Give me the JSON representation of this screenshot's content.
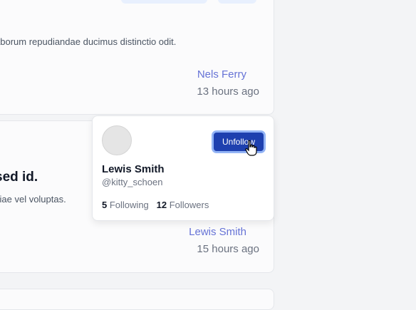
{
  "post1": {
    "excerpt": "aborum repudiandae ducimus distinctio odit.",
    "author": "Nels Ferry",
    "time": "13 hours ago"
  },
  "post2": {
    "title": "sed id.",
    "excerpt": "ciae vel voluptas.",
    "author": "Lewis Smith",
    "time": "15 hours ago"
  },
  "hovercard": {
    "name": "Lewis Smith",
    "handle": "@kitty_schoen",
    "following_count": "5",
    "following_label": "Following",
    "followers_count": "12",
    "followers_label": "Followers",
    "unfollow_label": "Unfollow"
  },
  "colors": {
    "accent": "#1e40af",
    "link": "#6673d6",
    "focus_ring": "#93b4f5"
  },
  "icons": {
    "cursor": "hand-pointer-icon"
  }
}
